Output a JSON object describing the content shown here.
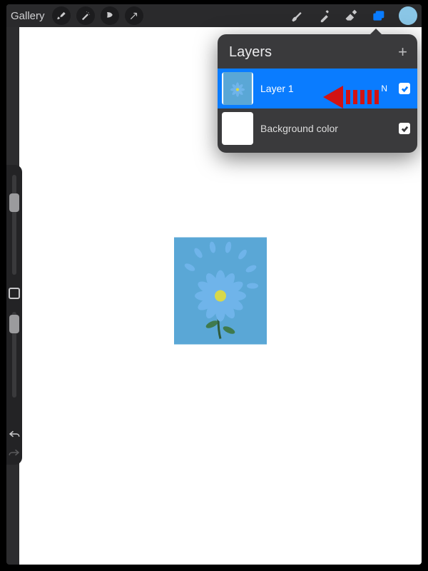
{
  "toolbar": {
    "gallery_label": "Gallery",
    "icons": {
      "wrench": "settings-wrench-icon",
      "wand": "adjustments-wand-icon",
      "select": "selection-s-icon",
      "move": "transform-arrow-icon",
      "brush": "brush-icon",
      "smudge": "smudge-icon",
      "eraser": "eraser-icon",
      "layers": "layers-icon",
      "color": "color-swatch"
    },
    "accent_color": "#0a7cff",
    "swatch_color": "#8ac6e6"
  },
  "layers_panel": {
    "title": "Layers",
    "add_label": "+",
    "items": [
      {
        "name": "Layer 1",
        "blend": "N",
        "checked": true,
        "selected": true
      },
      {
        "name": "Background color",
        "checked": true,
        "selected": false
      }
    ]
  },
  "annotation": {
    "kind": "swipe-left-arrow",
    "color": "#d11313"
  }
}
